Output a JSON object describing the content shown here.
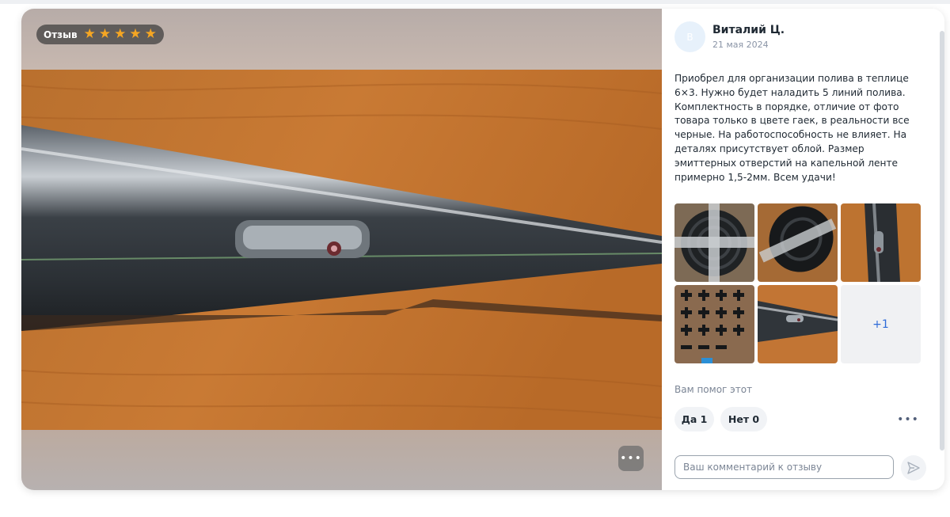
{
  "badge": {
    "label": "Отзыв",
    "rating": 5,
    "max_rating": 5,
    "star_color": "#f5a623"
  },
  "author": {
    "avatar_initial": "В",
    "name": "Виталий Ц.",
    "date": "21 мая 2024"
  },
  "review": {
    "text": "Приобрел для организации полива в теплице 6×3. Нужно будет наладить 5 линий полива. Комплектность в порядке, отличие от фото товара только в цвете гаек, в реальности все черные. На работоспособность не влияет. На деталях присутствует облой. Размер эмиттерных отверстий на капельной ленте примерно 1,5-2мм. Всем удачи!"
  },
  "thumbnails": {
    "images": [
      "drip-tape-roll-icon",
      "drip-tape-coil-icon",
      "drip-tape-closeup-icon",
      "fittings-icon",
      "emitter-closeup-icon"
    ],
    "more_label": "+1"
  },
  "helpful": {
    "question": "Вам помог этот",
    "yes_label": "Да 1",
    "no_label": "Нет 0"
  },
  "comment": {
    "placeholder": "Ваш комментарий к отзыву",
    "value": ""
  },
  "colors": {
    "accent": "#2e6bd8",
    "text": "#1f2933",
    "muted": "#7b8595"
  }
}
